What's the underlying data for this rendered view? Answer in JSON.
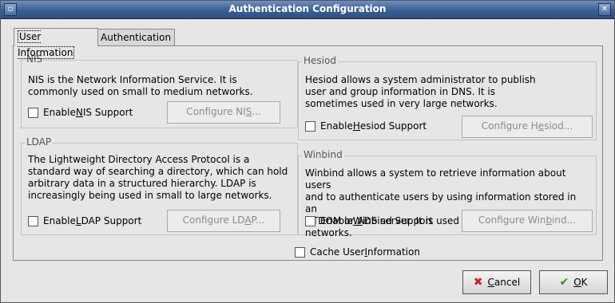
{
  "window": {
    "title": "Authentication Configuration"
  },
  "tabs": [
    {
      "label": "User Information",
      "active": true
    },
    {
      "label": "Authentication",
      "active": false
    }
  ],
  "nis": {
    "title": "NIS",
    "desc1": "NIS is the Network Information Service.  It is",
    "desc2": "commonly used on small to medium networks.",
    "enable_pre": "Enable ",
    "enable_mn": "N",
    "enable_post": "IS Support",
    "button_pre": "Configure NI",
    "button_mn": "S",
    "button_post": "...",
    "checked": false
  },
  "hesiod": {
    "title": "Hesiod",
    "desc1": "Hesiod allows a system administrator to publish",
    "desc2": "user and group information in DNS.  It is",
    "desc3": "sometimes used in very large networks.",
    "enable_pre": "Enable ",
    "enable_mn": "H",
    "enable_post": "esiod Support",
    "button_pre": "Configure H",
    "button_mn": "e",
    "button_post": "siod...",
    "checked": false
  },
  "ldap": {
    "title": "LDAP",
    "desc1": "The Lightweight Directory Access Protocol is a",
    "desc2": "standard way of searching a directory, which can hold",
    "desc3": "arbitrary data in a structured hierarchy.  LDAP is",
    "desc4": "increasingly being used in small to large networks.",
    "enable_pre": "Enable ",
    "enable_mn": "L",
    "enable_post": "DAP Support",
    "button_pre": "Configure LD",
    "button_mn": "A",
    "button_post": "P...",
    "checked": false
  },
  "winbind": {
    "title": "Winbind",
    "desc1": "Winbind allows a system to retrieve information about users",
    "desc2": "and to authenticate users by using information stored in an",
    "desc3": "NTDOM or ADS server.  It is used in small to large networks.",
    "enable_pre": "Enable ",
    "enable_mn": "W",
    "enable_post": "inbind Support",
    "button_pre": "Configure Win",
    "button_mn": "b",
    "button_post": "ind...",
    "checked": false
  },
  "cache": {
    "pre": "Cache User ",
    "mn": "I",
    "post": "nformation",
    "checked": false
  },
  "buttons": {
    "cancel_mn": "C",
    "cancel_post": "ancel",
    "ok_mn": "O",
    "ok_post": "K",
    "cancel_color": "#cc2222",
    "ok_color": "#3c8a1e"
  }
}
